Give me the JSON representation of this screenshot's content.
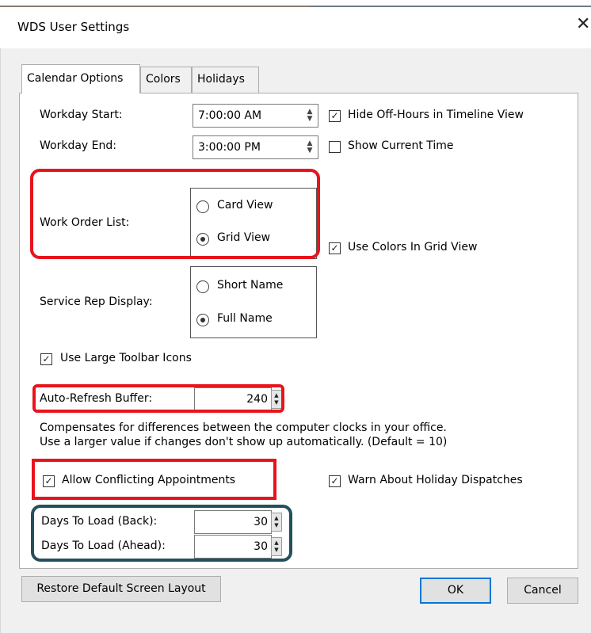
{
  "window": {
    "title": "WDS User Settings",
    "close_glyph": "✕"
  },
  "tabs": [
    {
      "label": "Calendar Options",
      "active": true
    },
    {
      "label": "Colors",
      "active": false
    },
    {
      "label": "Holidays",
      "active": false
    }
  ],
  "calendar": {
    "workday_start_label": "Workday Start:",
    "workday_start_value": "7:00:00 AM",
    "workday_end_label": "Workday End:",
    "workday_end_value": "3:00:00 PM",
    "hide_off_hours_label": "Hide Off-Hours in Timeline View",
    "hide_off_hours_checked": true,
    "show_current_time_label": "Show Current Time",
    "show_current_time_checked": false,
    "work_order_list_label": "Work Order List:",
    "card_view_label": "Card View",
    "grid_view_label": "Grid View",
    "work_order_list_selected": "Grid View",
    "use_colors_grid_label": "Use Colors In Grid View",
    "use_colors_grid_checked": true,
    "service_rep_display_label": "Service Rep Display:",
    "short_name_label": "Short Name",
    "full_name_label": "Full Name",
    "service_rep_selected": "Full Name",
    "large_toolbar_label": "Use Large Toolbar Icons",
    "large_toolbar_checked": true,
    "auto_refresh_label": "Auto-Refresh Buffer:",
    "auto_refresh_value": "240",
    "auto_refresh_help_1": "Compensates for differences between the computer clocks in your office.",
    "auto_refresh_help_2": "Use a larger value if changes don't show up automatically. (Default = 10)",
    "allow_conflicting_label": "Allow Conflicting Appointments",
    "allow_conflicting_checked": true,
    "warn_holiday_label": "Warn About Holiday Dispatches",
    "warn_holiday_checked": true,
    "days_back_label": "Days To Load (Back):",
    "days_back_value": "30",
    "days_ahead_label": "Days To Load (Ahead):",
    "days_ahead_value": "30"
  },
  "buttons": {
    "restore_label": "Restore Default Screen Layout",
    "ok_label": "OK",
    "cancel_label": "Cancel"
  },
  "glyphs": {
    "check": "✓",
    "spin_up": "▲",
    "spin_down": "▼"
  },
  "colors": {
    "highlight_red": "#e8141c",
    "highlight_teal": "#24505e",
    "default_button_border": "#0078d7"
  }
}
